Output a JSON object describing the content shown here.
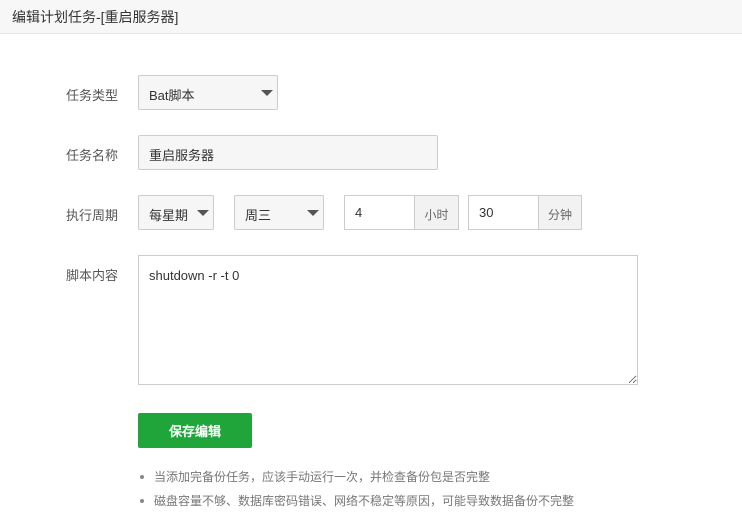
{
  "header": {
    "title": "编辑计划任务-[重启服务器]"
  },
  "form": {
    "task_type": {
      "label": "任务类型",
      "value": "Bat脚本"
    },
    "task_name": {
      "label": "任务名称",
      "value": "重启服务器"
    },
    "period": {
      "label": "执行周期",
      "cycle": "每星期",
      "weekday": "周三",
      "hour": "4",
      "hour_unit": "小时",
      "minute": "30",
      "minute_unit": "分钟"
    },
    "script": {
      "label": "脚本内容",
      "value": "shutdown -r -t 0"
    },
    "save_label": "保存编辑"
  },
  "tips": [
    "当添加完备份任务，应该手动运行一次，并检查备份包是否完整",
    "磁盘容量不够、数据库密码错误、网络不稳定等原因，可能导致数据备份不完整"
  ]
}
